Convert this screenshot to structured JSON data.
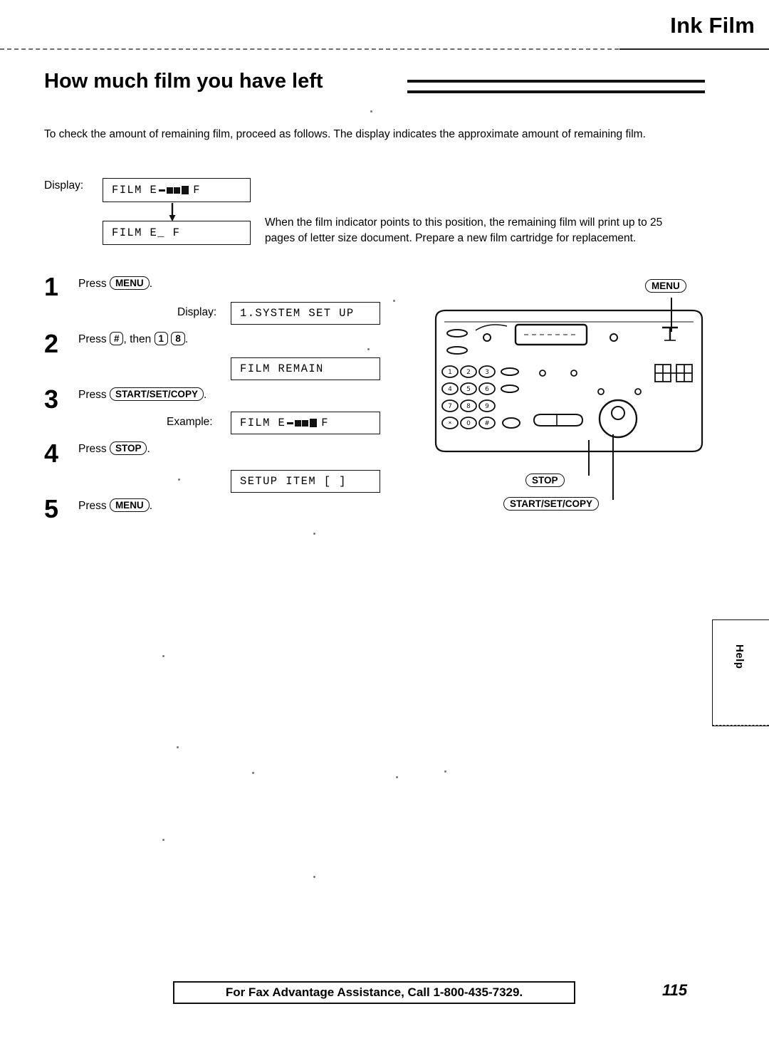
{
  "header": {
    "title": "Ink Film"
  },
  "section": {
    "title": "How much film you have left"
  },
  "intro": "To check the amount of remaining film, proceed as follows. The display indicates the approximate amount of remaining film.",
  "display_row": {
    "label": "Display:",
    "lcd_full": "FILM  E",
    "lcd_full_tail": "F",
    "lcd_low": "FILM  E_      F",
    "note": "When the film indicator points to this position, the remaining film will print up to 25 pages of letter size document. Prepare a new film cartridge for replacement."
  },
  "steps": [
    {
      "number": "1",
      "press_word": "Press",
      "keys": [
        "MENU"
      ],
      "trailing": ".",
      "sub_label": "Display:",
      "lcd": "1.SYSTEM SET UP"
    },
    {
      "number": "2",
      "press_word": "Press",
      "keys": [
        "#",
        "1",
        "8"
      ],
      "joiner": ", then",
      "trailing": ".",
      "lcd": "FILM REMAIN"
    },
    {
      "number": "3",
      "press_word": "Press",
      "keys": [
        "START/SET/COPY"
      ],
      "trailing": ".",
      "sub_label": "Example:",
      "lcd": "FILM  E",
      "lcd_tail": "F"
    },
    {
      "number": "4",
      "press_word": "Press",
      "keys": [
        "STOP"
      ],
      "trailing": ".",
      "lcd": "SETUP ITEM [   ]"
    },
    {
      "number": "5",
      "press_word": "Press",
      "keys": [
        "MENU"
      ],
      "trailing": "."
    }
  ],
  "machine_callouts": {
    "menu": "MENU",
    "stop": "STOP",
    "start_set_copy": "START/SET/COPY"
  },
  "keypad": {
    "rows": [
      [
        "1",
        "2",
        "3"
      ],
      [
        "4",
        "5",
        "6"
      ],
      [
        "7",
        "8",
        "9"
      ],
      [
        "*",
        "0",
        "#"
      ]
    ]
  },
  "side_tab": {
    "label": "Help"
  },
  "footer": {
    "text": "For Fax Advantage Assistance, Call 1-800-435-7329.",
    "page_number": "115"
  }
}
